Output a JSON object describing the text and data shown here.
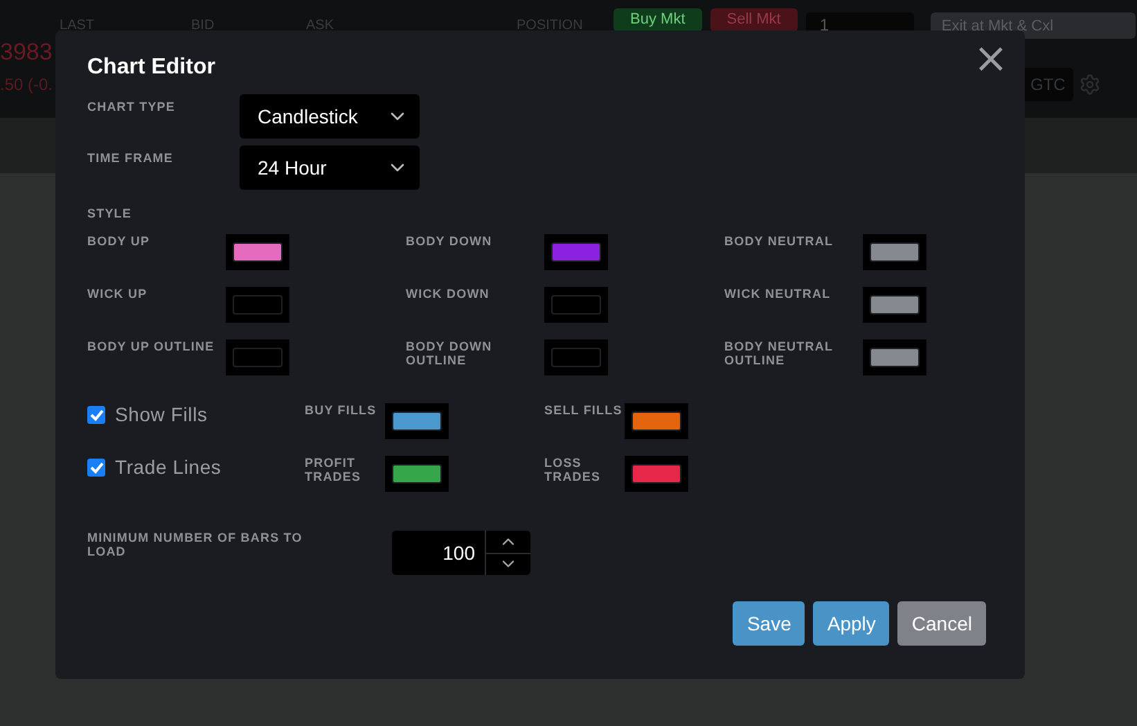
{
  "background": {
    "quote_last": "3983",
    "quote_change": ".50 (-0.",
    "headers": [
      "LAST",
      "BID",
      "ASK",
      "POSITION"
    ],
    "buy_button": "Buy Mkt",
    "sell_button": "Sell Mkt",
    "quantity": "1",
    "exit_button": "Exit at Mkt & Cxl",
    "tif_button": "GTC"
  },
  "dialog": {
    "title": "Chart Editor",
    "close": "×",
    "selects": [
      {
        "label": "CHART TYPE",
        "value": "Candlestick"
      },
      {
        "label": "TIME FRAME",
        "value": "24 Hour"
      }
    ],
    "style_heading": "STYLE",
    "style_colors": [
      {
        "label": "BODY UP",
        "color": "#e46bbd"
      },
      {
        "label": "BODY DOWN",
        "color": "#8a22e0"
      },
      {
        "label": "BODY NEUTRAL",
        "color": "#858990"
      },
      {
        "label": "WICK UP",
        "color": "#000000"
      },
      {
        "label": "WICK DOWN",
        "color": "#000000"
      },
      {
        "label": "WICK NEUTRAL",
        "color": "#858990"
      },
      {
        "label": "BODY UP OUTLINE",
        "color": "#000000"
      },
      {
        "label": "BODY DOWN OUTLINE",
        "color": "#000000"
      },
      {
        "label": "BODY NEUTRAL OUTLINE",
        "color": "#858990"
      }
    ],
    "toggles": [
      {
        "label": "Show Fills",
        "checked": true,
        "colors": [
          {
            "label": "BUY FILLS",
            "color": "#4b98cd"
          },
          {
            "label": "SELL FILLS",
            "color": "#e5650f"
          }
        ]
      },
      {
        "label": "Trade Lines",
        "checked": true,
        "colors": [
          {
            "label": "PROFIT TRADES",
            "color": "#36a64a"
          },
          {
            "label": "LOSS TRADES",
            "color": "#e6274a"
          }
        ]
      }
    ],
    "min_bars": {
      "label": "MINIMUM NUMBER OF BARS TO LOAD",
      "value": "100"
    },
    "buttons": [
      {
        "label": "Save",
        "kind": "primary"
      },
      {
        "label": "Apply",
        "kind": "primary"
      },
      {
        "label": "Cancel",
        "kind": "secondary"
      }
    ]
  }
}
